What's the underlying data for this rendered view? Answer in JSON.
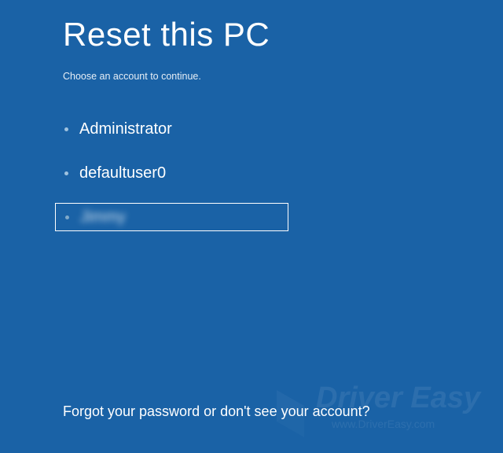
{
  "title": "Reset this PC",
  "subtitle": "Choose an account to continue.",
  "accounts": [
    {
      "label": "Administrator",
      "selected": false,
      "blurred": false
    },
    {
      "label": "defaultuser0",
      "selected": false,
      "blurred": false
    },
    {
      "label": "Jimmy",
      "selected": true,
      "blurred": true
    }
  ],
  "footer_link": "Forgot your password or don't see your account?",
  "watermark": {
    "brand": "Driver Easy",
    "url": "www.DriverEasy.com"
  },
  "colors": {
    "background": "#1a62a6",
    "text": "#ffffff"
  }
}
